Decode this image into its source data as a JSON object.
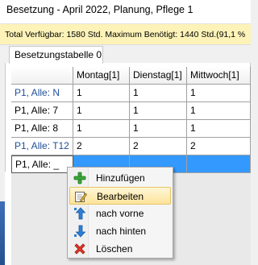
{
  "window": {
    "title": "Besetzung - April 2022, Planung, Pflege 1"
  },
  "infobar": {
    "text": "Total Verfügbar: 1580 Std.  Maximum Benötigt: 1440 Std.(91,1 %"
  },
  "tabs": [
    {
      "label": "Besetzungstabelle 0"
    }
  ],
  "grid": {
    "columns": [
      "Montag[1]",
      "Dienstag[1]",
      "Mittwoch[1]"
    ],
    "rows": [
      {
        "label": "P1, Alle: N",
        "values": [
          "1",
          "1",
          "1"
        ]
      },
      {
        "label": "P1, Alle: 7",
        "values": [
          "1",
          "1",
          "1"
        ]
      },
      {
        "label": "P1, Alle: 8",
        "values": [
          "1",
          "1",
          "1"
        ]
      },
      {
        "label": "P1, Alle: T12",
        "values": [
          "2",
          "2",
          "2"
        ]
      },
      {
        "label": "P1, Alle: _",
        "values": [
          "",
          "",
          ""
        ]
      }
    ]
  },
  "context_menu": {
    "items": [
      {
        "label": "Hinzufügen",
        "icon": "plus-icon"
      },
      {
        "label": "Bearbeiten",
        "icon": "edit-icon",
        "highlighted": true
      },
      {
        "label": "nach vorne",
        "icon": "move-up-icon"
      },
      {
        "label": "nach hinten",
        "icon": "move-down-icon"
      },
      {
        "label": "Löschen",
        "icon": "delete-icon"
      }
    ]
  },
  "colors": {
    "selection": "#3399ff",
    "row_label": "#1f4f9a",
    "infobar": "#fdf3b8",
    "highlight": "#fde49a"
  }
}
